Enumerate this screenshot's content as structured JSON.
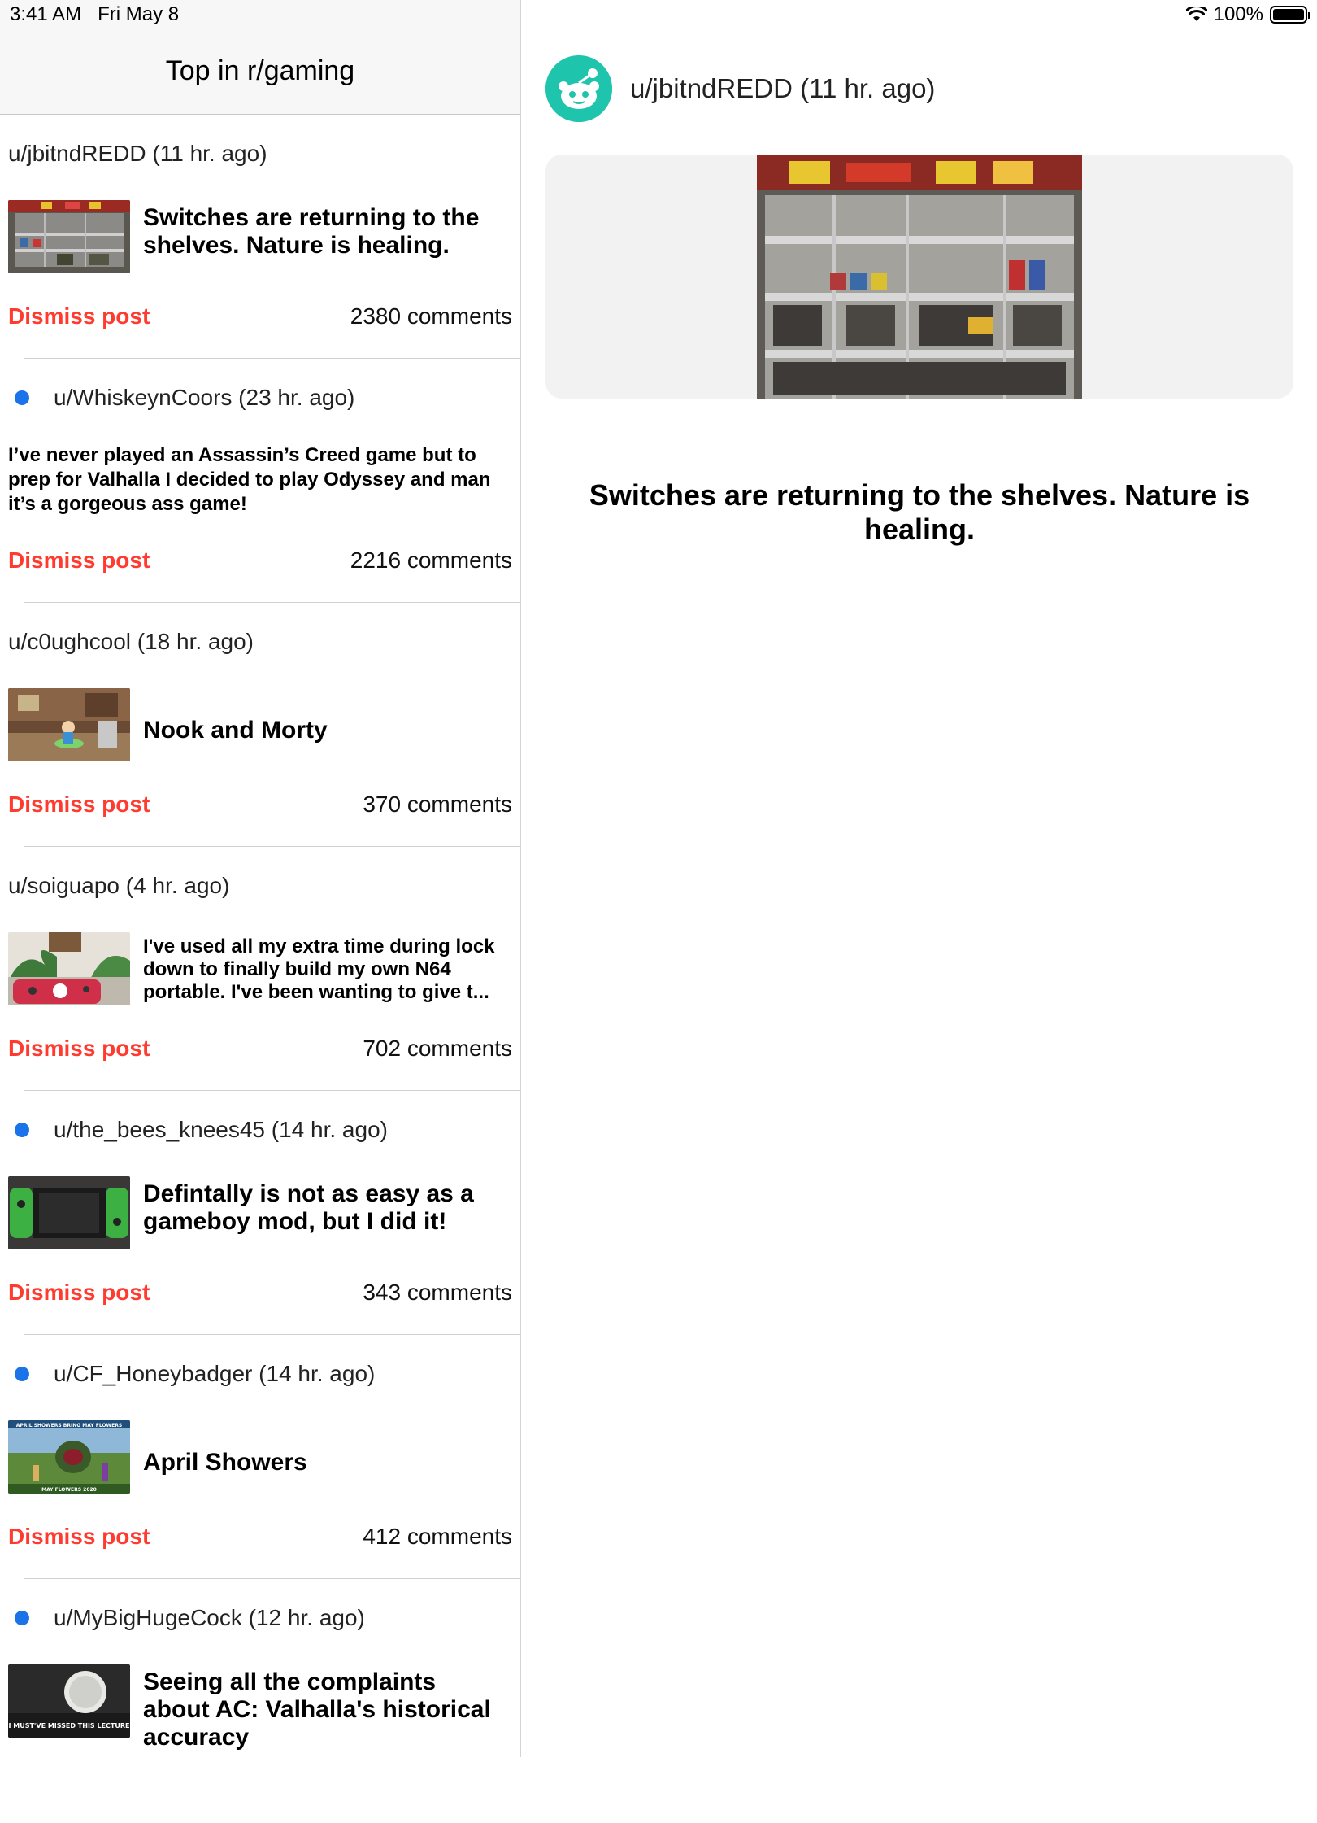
{
  "status_bar": {
    "time": "3:41 AM",
    "date": "Fri May 8",
    "battery": "100%"
  },
  "nav": {
    "title": "Top in r/gaming"
  },
  "posts": [
    {
      "author": "u/jbitndREDD (11 hr. ago)",
      "title": "Switches are returning to the shelves. Nature is healing.",
      "comments": "2380 comments",
      "dismiss": "Dismiss post"
    },
    {
      "author": "u/WhiskeynCoors (23 hr. ago)",
      "title": "I’ve never played an Assassin’s Creed game but to prep for Valhalla I decided to play Odyssey and man it’s a gorgeous ass game!",
      "comments": "2216 comments",
      "dismiss": "Dismiss post"
    },
    {
      "author": "u/c0ughcool (18 hr. ago)",
      "title": "Nook and Morty",
      "comments": "370 comments",
      "dismiss": "Dismiss post"
    },
    {
      "author": "u/soiguapo (4 hr. ago)",
      "title": "I've used all my extra time during lock down to finally build my own N64 portable. I've been wanting to give t...",
      "comments": "702 comments",
      "dismiss": "Dismiss post"
    },
    {
      "author": "u/the_bees_knees45 (14 hr. ago)",
      "title": "Defintally is not as easy as a gameboy mod, but I did it!",
      "comments": "343 comments",
      "dismiss": "Dismiss post"
    },
    {
      "author": "u/CF_Honeybadger (14 hr. ago)",
      "title": "April Showers",
      "comments": "412 comments",
      "dismiss": "Dismiss post"
    },
    {
      "author": "u/MyBigHugeCock (12 hr. ago)",
      "title": "Seeing all the complaints about AC: Valhalla's historical accuracy"
    }
  ],
  "thumb_text": {
    "april": "APRIL SHOWERS BRING MAY FLOWERS",
    "may": "MAY FLOWERS 2020",
    "lecture": "I MUST'VE MISSED THIS LECTURE"
  },
  "detail": {
    "author": "u/jbitndREDD (11 hr. ago)",
    "title": "Switches are returning to the shelves. Nature is healing."
  },
  "colors": {
    "accent_red": "#ff3b30",
    "unread_blue": "#1a73e8",
    "avatar_teal": "#1fc4ad"
  }
}
